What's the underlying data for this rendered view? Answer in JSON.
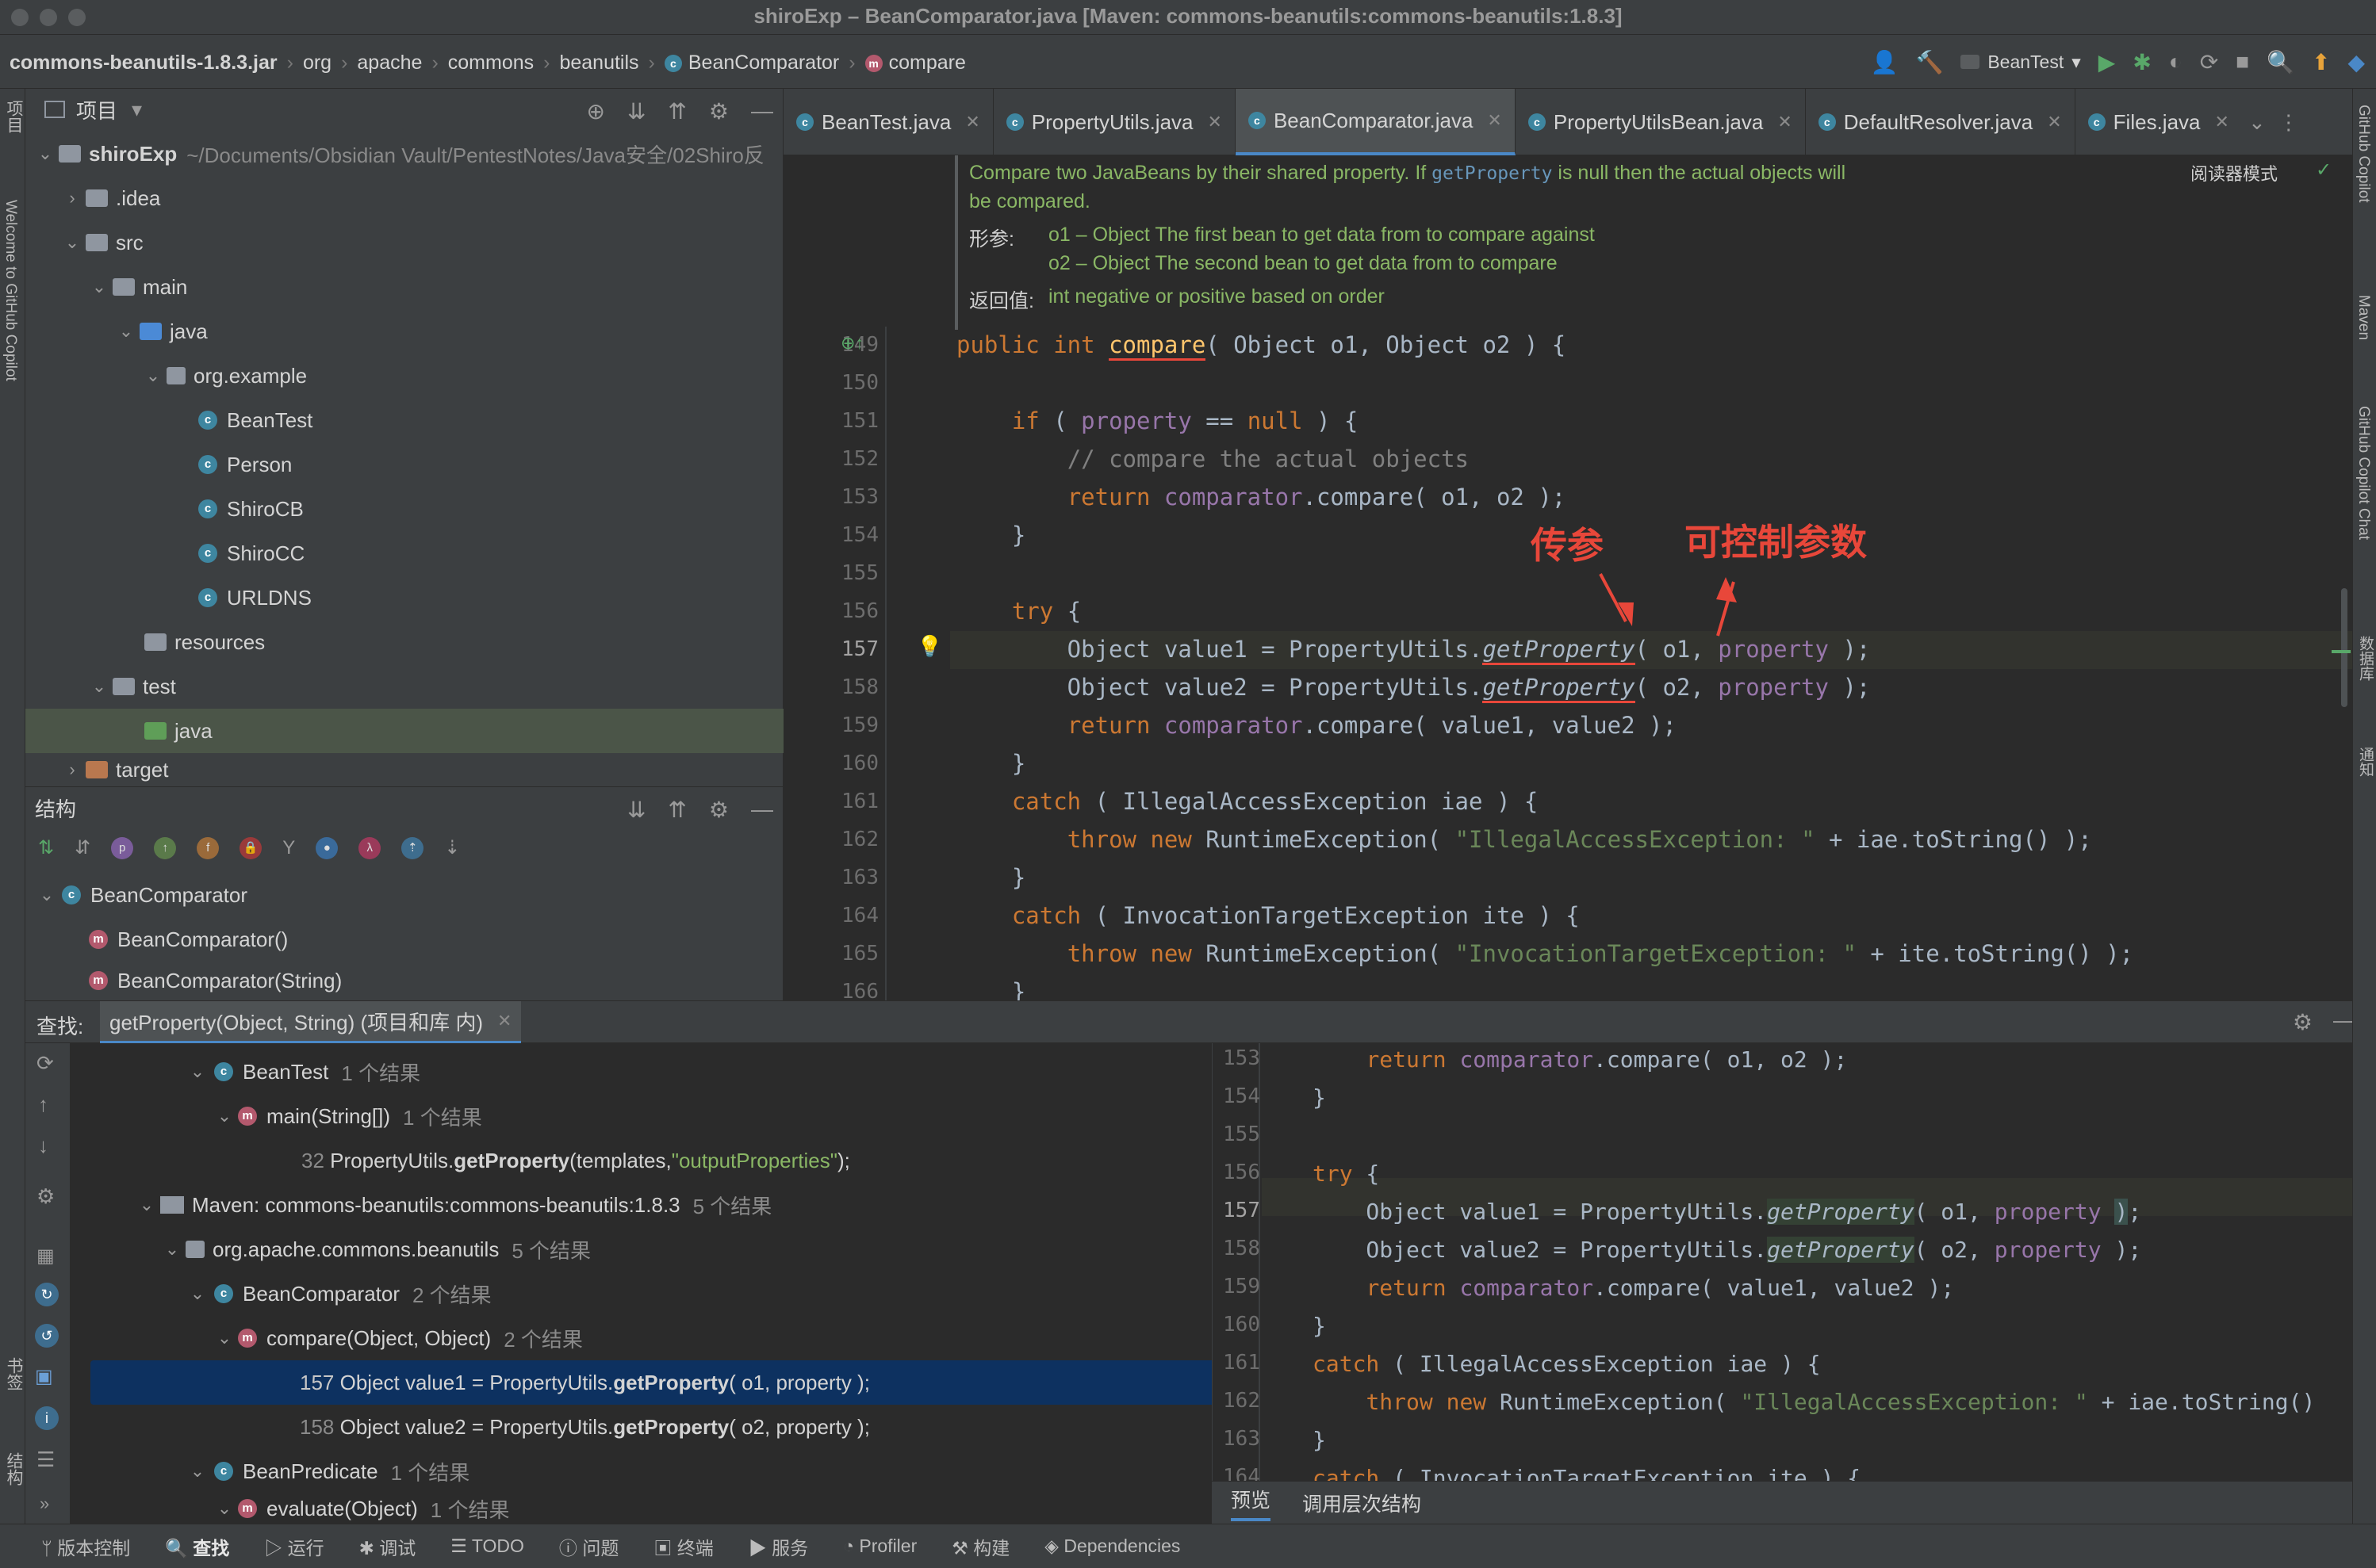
{
  "window": {
    "title": "shiroExp – BeanComparator.java [Maven: commons-beanutils:commons-beanutils:1.8.3]"
  },
  "breadcrumb": [
    "commons-beanutils-1.8.3.jar",
    "org",
    "apache",
    "commons",
    "beanutils",
    "BeanComparator",
    "compare"
  ],
  "run_config": "BeanTest",
  "left_strip": {
    "project": "项目",
    "copilot": "Welcome to GitHub Copilot",
    "bookmarks": "书签",
    "structure": "结构"
  },
  "right_strip": {
    "copilot": "GitHub Copilot",
    "maven": "Maven",
    "copilot_chat": "GitHub Copilot Chat",
    "database": "数据库",
    "notifications": "通知"
  },
  "project_panel": {
    "title": "项目",
    "root_name": "shiroExp",
    "root_path": "~/Documents/Obsidian Vault/PentestNotes/Java安全/02Shiro反",
    "items": {
      "idea": ".idea",
      "src": "src",
      "main": "main",
      "java": "java",
      "pkg": "org.example",
      "c1": "BeanTest",
      "c2": "Person",
      "c3": "ShiroCB",
      "c4": "ShiroCC",
      "c5": "URLDNS",
      "resources": "resources",
      "test": "test",
      "testjava": "java",
      "target": "target"
    }
  },
  "structure_panel": {
    "title": "结构",
    "class_name": "BeanComparator",
    "members": [
      "BeanComparator()",
      "BeanComparator(String)"
    ]
  },
  "tabs": [
    "BeanTest.java",
    "PropertyUtils.java",
    "BeanComparator.java",
    "PropertyUtilsBean.java",
    "DefaultResolver.java",
    "Files.java"
  ],
  "doc": {
    "line1_pre": "Compare two JavaBeans by their shared property. If ",
    "line1_code": "getProperty",
    "line1_post": " is null then the actual objects will",
    "line2": "be compared.",
    "params_label": "形参:",
    "param1": "o1 – Object The first bean to get data from to compare against",
    "param2": "o2 – Object The second bean to get data from to compare",
    "returns_label": "返回值:",
    "returns": "int negative or positive based on order",
    "reader_mode": "阅读器模式"
  },
  "line_numbers": [
    "149",
    "150",
    "151",
    "152",
    "153",
    "154",
    "155",
    "156",
    "157",
    "158",
    "159",
    "160",
    "161",
    "162",
    "163",
    "164",
    "165",
    "166"
  ],
  "annotations": {
    "left": "传参",
    "right": "可控制参数"
  },
  "find_panel": {
    "label": "查找:",
    "query": "getProperty(Object, String) (项目和库 内)",
    "rows": {
      "r1_name": "BeanTest",
      "r1_count": "1 个结果",
      "r2_name": "main(String[])",
      "r2_count": "1 个结果",
      "r3_num": "32",
      "r3_pre": "PropertyUtils.",
      "r3_bold": "getProperty",
      "r3_post": "(templates,",
      "r3_str": "\"outputProperties\"",
      "r3_end": ");",
      "r4_name": "Maven: commons-beanutils:commons-beanutils:1.8.3",
      "r4_count": "5 个结果",
      "r5_name": "org.apache.commons.beanutils",
      "r5_count": "5 个结果",
      "r6_name": "BeanComparator",
      "r6_count": "2 个结果",
      "r7_name": "compare(Object, Object)",
      "r7_count": "2 个结果",
      "r8_num": "157",
      "r8_pre": "Object value1 = PropertyUtils.",
      "r8_bold": "getProperty",
      "r8_post": "( o1, property );",
      "r9_num": "158",
      "r9_pre": "Object value2 = PropertyUtils.",
      "r9_bold": "getProperty",
      "r9_post": "( o2, property );",
      "r10_name": "BeanPredicate",
      "r10_count": "1 个结果",
      "r11_name": "evaluate(Object)",
      "r11_count": "1 个结果"
    }
  },
  "preview": {
    "line_numbers": [
      "153",
      "154",
      "155",
      "156",
      "157",
      "158",
      "159",
      "160",
      "161",
      "162",
      "163",
      "164"
    ],
    "tabs": [
      "预览",
      "调用层次结构"
    ]
  },
  "statusbar": [
    "版本控制",
    "查找",
    "运行",
    "调试",
    "TODO",
    "问题",
    "终端",
    "服务",
    "Profiler",
    "构建",
    "Dependencies"
  ]
}
